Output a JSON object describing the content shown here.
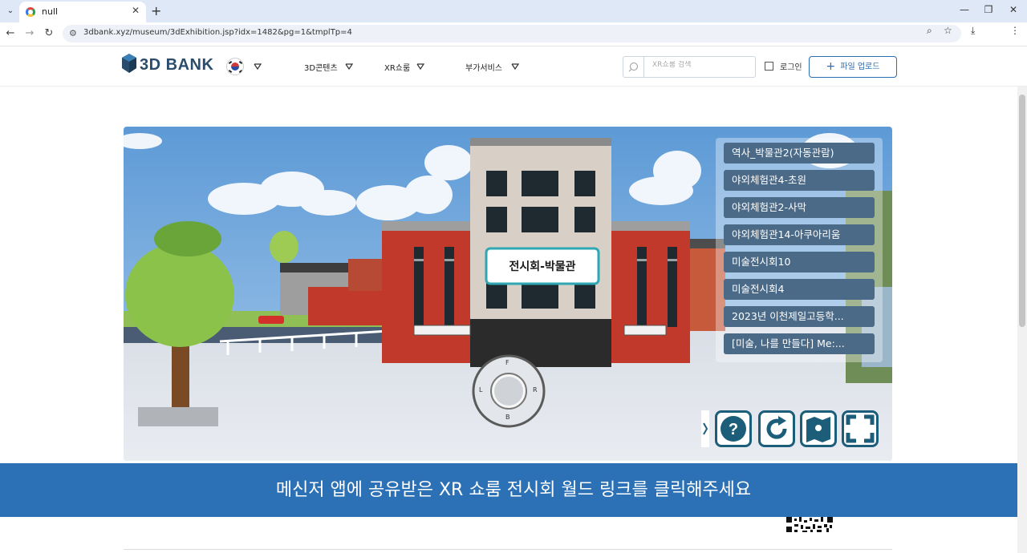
{
  "browser": {
    "tab_title": "null",
    "url": "3dbank.xyz/museum/3dExhibition.jsp?idx=1482&pg=1&tmplTp=4"
  },
  "header": {
    "logo_text": "3D BANK",
    "menu": [
      "3D콘텐츠",
      "XR쇼룸",
      "부가서비스"
    ],
    "search_placeholder": "XR쇼룸 검색",
    "login_label": "로그인",
    "upload_label": "파일 업로드"
  },
  "viewer": {
    "building_sign": "전시회-박물관",
    "joystick_labels": [
      "F",
      "L",
      "R",
      "B"
    ],
    "rooms": [
      "역사_박물관2(자동관람)",
      "야외체험관4-초원",
      "야외체험관2-사막",
      "야외체험관14-아쿠아리움",
      "미술전시회10",
      "미술전시회4",
      "2023년 이천제일고등학...",
      "[미술, 나를 만들다] Me:..."
    ],
    "controls": [
      "help-icon",
      "refresh-icon",
      "map-icon",
      "fullscreen-icon"
    ]
  },
  "banner": {
    "text": "메신저 앱에 공유받은 XR 쇼룸 전시회 월드 링크를 클릭해주세요"
  },
  "colors": {
    "brand": "#2a4d6e",
    "accent": "#2c71b5",
    "room_button": "#4a6a88",
    "control_border": "#1c5e7a"
  }
}
